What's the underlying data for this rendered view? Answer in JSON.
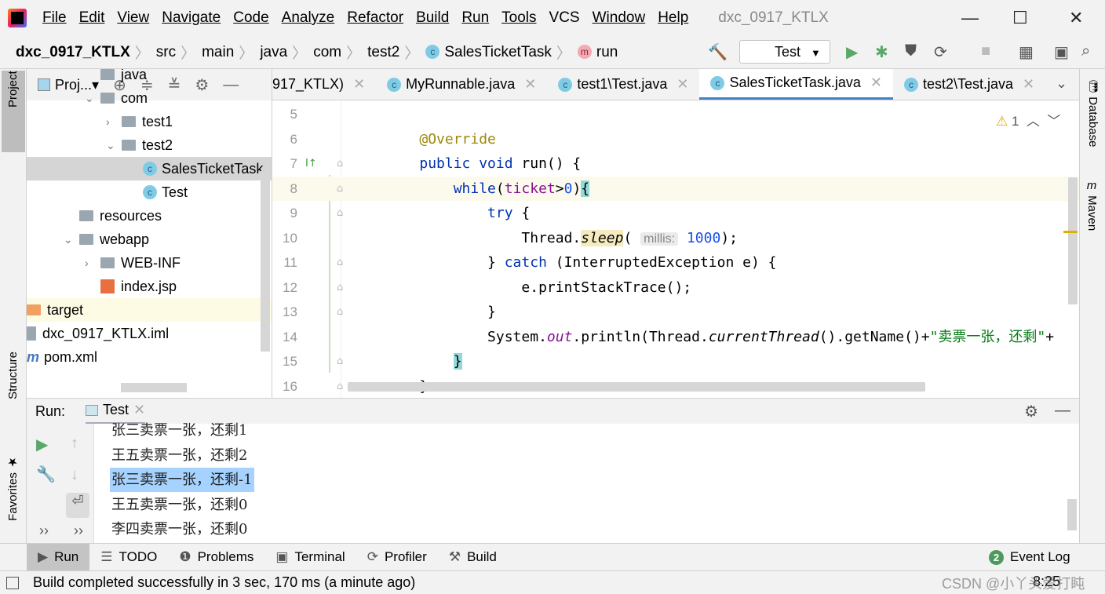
{
  "window": {
    "title": "dxc_0917_KTLX",
    "menu": [
      "File",
      "Edit",
      "View",
      "Navigate",
      "Code",
      "Analyze",
      "Refactor",
      "Build",
      "Run",
      "Tools",
      "VCS",
      "Window",
      "Help"
    ]
  },
  "breadcrumb": [
    "dxc_0917_KTLX",
    "src",
    "main",
    "java",
    "com",
    "test2",
    "SalesTicketTask",
    "run"
  ],
  "run_config": "Test",
  "side_tabs": {
    "left": [
      "Project",
      "Structure",
      "Favorites"
    ],
    "right": [
      "Database",
      "Maven"
    ]
  },
  "project": {
    "header": "Proj...",
    "items": [
      {
        "label": "java",
        "depth": 2,
        "type": "folder"
      },
      {
        "label": "com",
        "depth": 2,
        "type": "folder",
        "expanded": true
      },
      {
        "label": "test1",
        "depth": 3,
        "type": "folder",
        "expanded": false
      },
      {
        "label": "test2",
        "depth": 3,
        "type": "folder",
        "expanded": true
      },
      {
        "label": "SalesTicketTask",
        "depth": 4,
        "type": "class",
        "selected": true
      },
      {
        "label": "Test",
        "depth": 4,
        "type": "class"
      },
      {
        "label": "resources",
        "depth": 1,
        "type": "folder"
      },
      {
        "label": "webapp",
        "depth": 1,
        "type": "folder",
        "expanded": true
      },
      {
        "label": "WEB-INF",
        "depth": 2,
        "type": "folder",
        "expanded": false
      },
      {
        "label": "index.jsp",
        "depth": 2,
        "type": "jsp"
      },
      {
        "label": "target",
        "depth": 0,
        "type": "folder"
      },
      {
        "label": "dxc_0917_KTLX.iml",
        "depth": 0,
        "type": "file"
      },
      {
        "label": "pom.xml",
        "depth": 0,
        "type": "maven"
      }
    ]
  },
  "tabs": [
    {
      "label": "917_KTLX)"
    },
    {
      "label": "MyRunnable.java"
    },
    {
      "label": "test1\\Test.java"
    },
    {
      "label": "SalesTicketTask.java",
      "active": true
    },
    {
      "label": "test2\\Test.java"
    }
  ],
  "editor": {
    "warnings": "1",
    "lines": [
      {
        "n": "5",
        "html": ""
      },
      {
        "n": "6",
        "html": "    <span class='ann'>@Override</span>"
      },
      {
        "n": "7",
        "html": "    <span class='kw'>public void</span> run() {"
      },
      {
        "n": "8",
        "html": "        <span class='kw'>while</span>(<span class='var'>ticket</span>&gt;<span class='num'>0</span>)<span class='brace'>{</span>"
      },
      {
        "n": "9",
        "html": "            <span class='kw'>try</span> {"
      },
      {
        "n": "10",
        "html": "                Thread.<span class='it' style='background:#f5eac0'>sleep</span>( <span class='hint'>millis:</span> <span class='num'>1000</span>);"
      },
      {
        "n": "11",
        "html": "            } <span class='kw'>catch</span> (InterruptedException e) {"
      },
      {
        "n": "12",
        "html": "                e.printStackTrace();"
      },
      {
        "n": "13",
        "html": "            }"
      },
      {
        "n": "14",
        "html": "            System.<span class='fld'>out</span>.println(Thread.<span class='it'>currentThread</span>().getName()+<span class='str'>\"卖票一张，还剩\"</span>+"
      },
      {
        "n": "15",
        "html": "        <span class='brace'>}</span>"
      },
      {
        "n": "16",
        "html": "    }"
      }
    ]
  },
  "run": {
    "label": "Run:",
    "tab": "Test",
    "output": [
      "张三卖票一张，还剩1",
      "王五卖票一张，还剩2",
      "张三卖票一张，还剩-1",
      "王五卖票一张，还剩0",
      "李四卖票一张，还剩0"
    ],
    "selected_index": 2
  },
  "bottom_tools": [
    "Run",
    "TODO",
    "Problems",
    "Terminal",
    "Profiler",
    "Build"
  ],
  "event_log": {
    "label": "Event Log",
    "count": "2"
  },
  "status": {
    "message": "Build completed successfully in 3 sec, 170 ms (a minute ago)",
    "time": "8:25",
    "watermark": "CSDN @小丫头爱打盹"
  },
  "colors": {
    "accent": "#4083c9",
    "selection": "#a6d2ff",
    "run_green": "#59a869"
  }
}
